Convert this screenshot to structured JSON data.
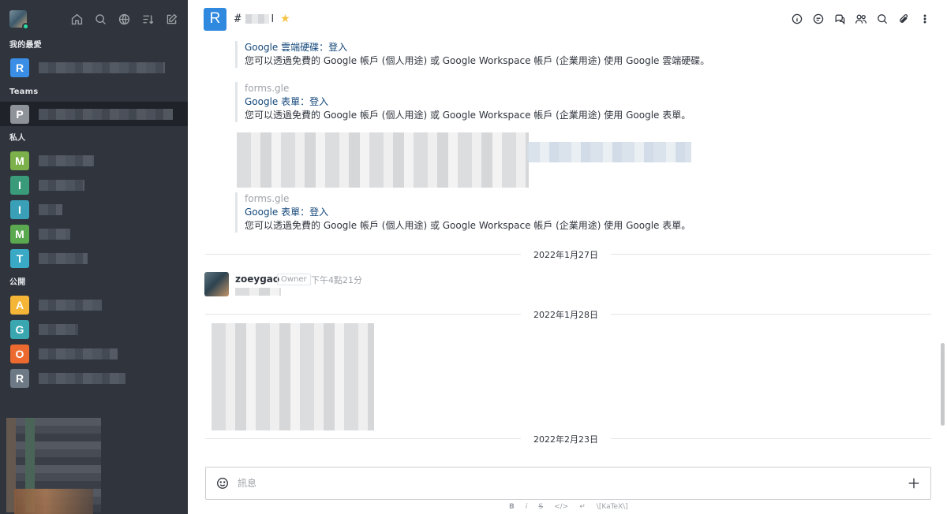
{
  "sidebar": {
    "sections": {
      "favorites": "我的最愛",
      "teams": "Teams",
      "private": "私人",
      "public": "公開"
    },
    "favorites": [
      {
        "letter": "R",
        "color": "#3b8ee5"
      }
    ],
    "teams": [
      {
        "letter": "P",
        "color": "#8e9299"
      }
    ],
    "private": [
      {
        "letter": "M",
        "color": "#7bb04b"
      },
      {
        "letter": "I",
        "color": "#3a9b7a"
      },
      {
        "letter": "I",
        "color": "#3aa0b8"
      },
      {
        "letter": "M",
        "color": "#5aa84f"
      },
      {
        "letter": "T",
        "color": "#39a9c6"
      }
    ],
    "public": [
      {
        "letter": "A",
        "color": "#f5b537"
      },
      {
        "letter": "G",
        "color": "#3aa7b0"
      },
      {
        "letter": "O",
        "color": "#ec6a2f"
      },
      {
        "letter": "R",
        "color": "#6d7a86"
      }
    ]
  },
  "header": {
    "room_letter": "R",
    "room_name": "l"
  },
  "messages": {
    "preview1": {
      "title": "Google 雲端硬碟：登入",
      "desc": "您可以透過免費的 Google 帳戶 (個人用途) 或 Google Workspace 帳戶 (企業用途) 使用 Google 雲端硬碟。"
    },
    "preview2": {
      "domain": "forms.gle",
      "title": "Google 表單：登入",
      "desc": "您可以透過免費的 Google 帳戶 (個人用途) 或 Google Workspace 帳戶 (企業用途) 使用 Google 表單。"
    },
    "preview3": {
      "domain": "forms.gle",
      "title": "Google 表單：登入",
      "desc": "您可以透過免費的 Google 帳戶 (個人用途) 或 Google Workspace 帳戶 (企業用途) 使用 Google 表單。"
    },
    "dividers": [
      "2022年1月27日",
      "2022年1月28日",
      "2022年2月23日"
    ],
    "author": {
      "name": "zoeygao",
      "role": "Owner",
      "time": "下午4點21分"
    }
  },
  "composer": {
    "placeholder": "訊息",
    "format": {
      "bold": "B",
      "italic": "i",
      "strike": "S",
      "code": "</>",
      "katex": "\\[KaTeX\\]"
    }
  }
}
